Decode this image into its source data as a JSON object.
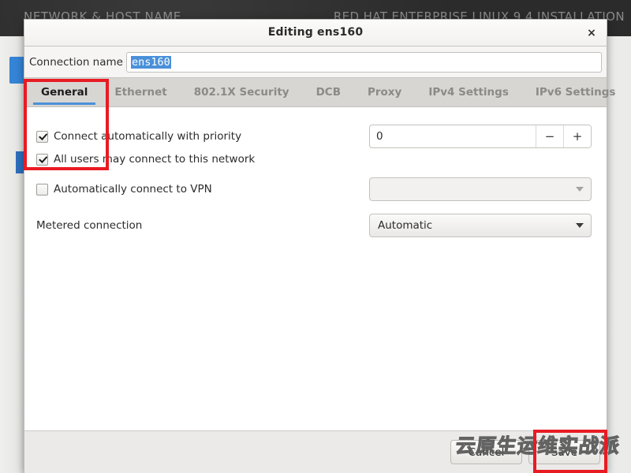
{
  "background": {
    "screen_title_left": "NETWORK & HOST NAME",
    "screen_title_right": "RED HAT ENTERPRISE LINUX 9.4 INSTALLATION",
    "bottom_glyph": "",
    "right_glyph": ""
  },
  "dialog": {
    "title": "Editing ens160",
    "close_icon": "×",
    "connection_name": {
      "label": "Connection name",
      "value": "ens160",
      "placeholder": ""
    },
    "tabs": [
      {
        "label": "General",
        "active": true
      },
      {
        "label": "Ethernet",
        "active": false
      },
      {
        "label": "802.1X Security",
        "active": false
      },
      {
        "label": "DCB",
        "active": false
      },
      {
        "label": "Proxy",
        "active": false
      },
      {
        "label": "IPv4 Settings",
        "active": false
      },
      {
        "label": "IPv6 Settings",
        "active": false
      }
    ],
    "general": {
      "connect_automatically": {
        "label": "Connect automatically with priority",
        "checked": true
      },
      "all_users": {
        "label": "All users may connect to this network",
        "checked": true
      },
      "auto_vpn": {
        "label": "Automatically connect to VPN",
        "checked": false
      },
      "priority": {
        "value": "0",
        "decrement_label": "−",
        "increment_label": "+"
      },
      "vpn_combo": {
        "value": "",
        "enabled": false
      },
      "metered": {
        "label": "Metered connection",
        "value": "Automatic"
      }
    },
    "actions": {
      "cancel": "Cancel",
      "save": "Save"
    }
  },
  "watermark": {
    "text": "云原生运维实战派"
  },
  "annotations": {
    "general_box": "highlight-general-tab-and-checkboxes",
    "save_box": "highlight-save-button"
  },
  "colors": {
    "accent": "#4a90d9",
    "annotation": "#e81b23",
    "header_bg": "#2b2b2b",
    "dialog_bg": "#f6f5f4",
    "tabbar_bg": "#d7d6d3"
  }
}
